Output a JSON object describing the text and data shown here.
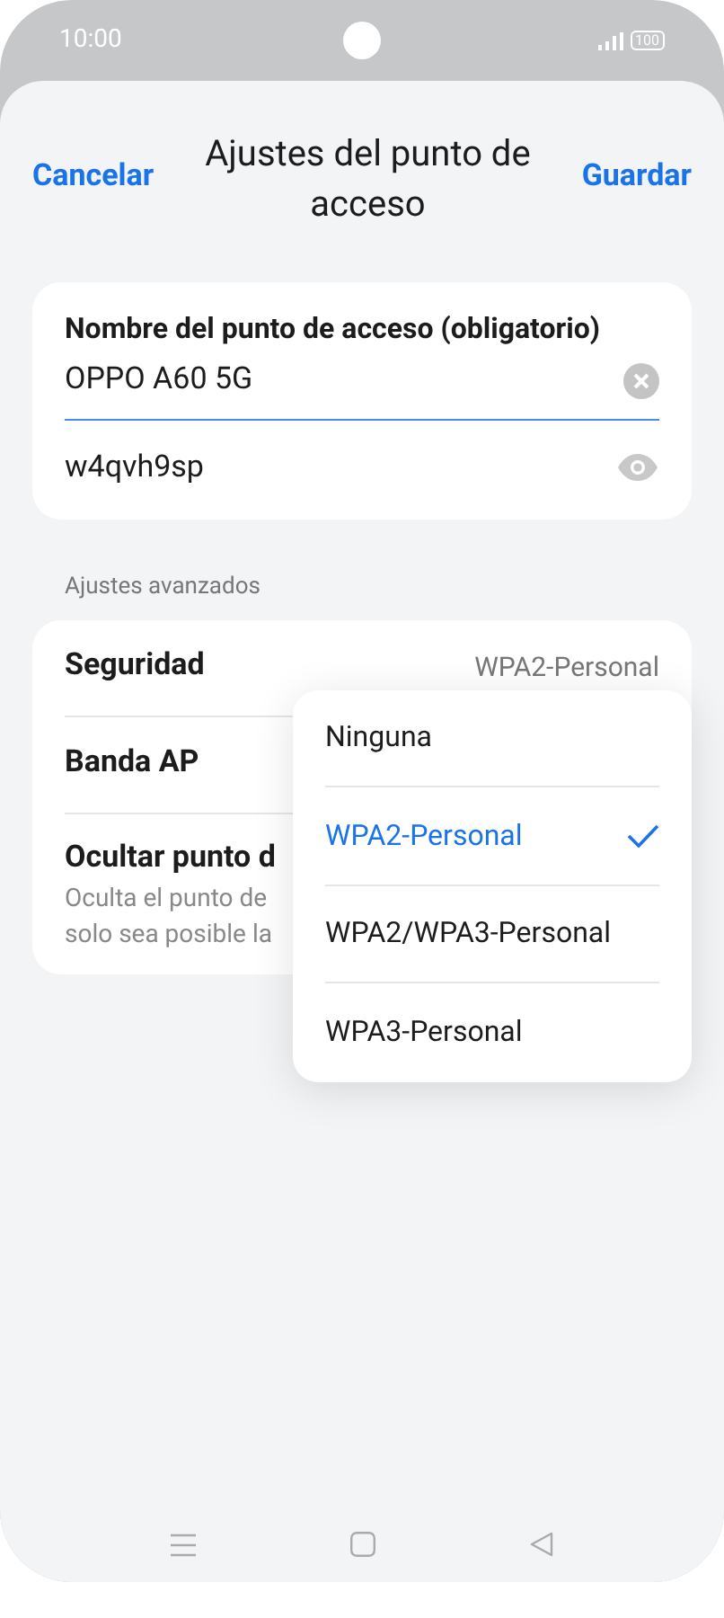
{
  "status_bar": {
    "time": "10:00",
    "battery": "100"
  },
  "header": {
    "cancel": "Cancelar",
    "title": "Ajustes del punto de acceso",
    "save": "Guardar"
  },
  "name_field": {
    "label": "Nombre del punto de acceso (obligatorio)",
    "value": "OPPO A60 5G"
  },
  "password_field": {
    "value": "w4qvh9sp"
  },
  "section_label": "Ajustes avanzados",
  "settings": [
    {
      "kind": "value",
      "label": "Seguridad",
      "value": "WPA2-Personal"
    },
    {
      "kind": "plain",
      "label": "Banda AP"
    },
    {
      "kind": "description",
      "label": "Ocultar punto d",
      "lines": [
        "Oculta el punto de",
        "solo sea posible la"
      ]
    }
  ],
  "security_menu": [
    {
      "label": "Ninguna",
      "selected": false
    },
    {
      "label": "WPA2-Personal",
      "selected": true
    },
    {
      "label": "WPA2/WPA3-Personal",
      "selected": false
    },
    {
      "label": "WPA3-Personal",
      "selected": false
    }
  ]
}
